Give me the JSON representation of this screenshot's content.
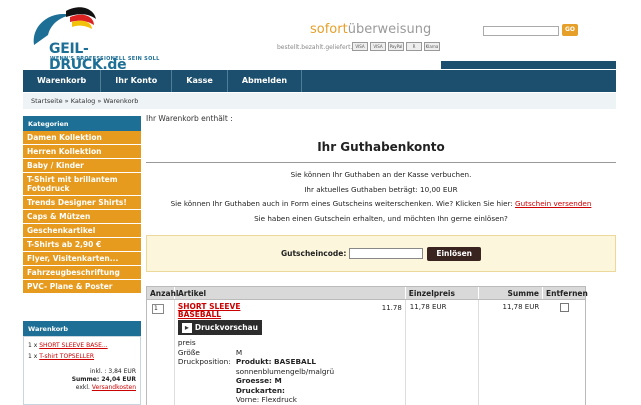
{
  "brand": {
    "logo_text": "GEIL-DRUCK.de",
    "logo_sub": "WENN'S PROFESSIONELL SEIN SOLL"
  },
  "payment": {
    "sofort_a": "sofort",
    "sofort_b": "überweisung",
    "tagline": "bestellt.bezahlt.geliefert.",
    "badges": [
      "VISA",
      "VISA",
      "PayPal",
      "R",
      "Klarna"
    ]
  },
  "search": {
    "placeholder": "",
    "button_label": "GO"
  },
  "nav": {
    "items": [
      "Warenkorb",
      "Ihr Konto",
      "Kasse",
      "Abmelden"
    ]
  },
  "breadcrumb": "Startseite » Katalog » Warenkorb",
  "sidebar": {
    "heading": "Kategorien",
    "items": [
      "Damen Kollektion",
      "Herren Kollektion",
      "Baby / Kinder",
      "T-Shirt mit brillantem Fotodruck",
      "Trends Designer Shirts!",
      "Caps & Mützen",
      "Geschenkartikel",
      "T-Shirts ab 2,90 €",
      "Flyer, Visitenkarten...",
      "Fahrzeugbeschriftung",
      "PVC- Plane & Poster"
    ]
  },
  "cart_box": {
    "heading": "Warenkorb",
    "line1_qty": "1 x",
    "line1_link": "SHORT SLEEVE BASE...",
    "line2_qty": "1 x",
    "line2_link": "T-shirt TOPSELLER",
    "incl": "inkl. : 3,84 EUR",
    "sum": "Summe: 24,04 EUR",
    "excl_prefix": "exkl.",
    "excl_link": "Versandkosten"
  },
  "main": {
    "intro": "Ihr Warenkorb enthält :",
    "title": "Ihr Guthabenkonto",
    "line1": "Sie können Ihr Guthaben an der Kasse verbuchen.",
    "line2": "Ihr aktuelles Guthaben beträgt: 10,00 EUR",
    "line3_text": "Sie können Ihr Guthaben auch in Form eines Gutscheins weiterschenken. Wie? Klicken Sie hier:",
    "line3_link": "Gutschein versenden",
    "line4": "Sie haben einen Gutschein erhalten, und möchten Ihn gerne einlösen?",
    "voucher_label": "Gutscheincode:",
    "voucher_value": "",
    "voucher_button": "Einlösen"
  },
  "table": {
    "headers": [
      "Anzahl",
      "Artikel",
      "Einzelpreis",
      "Summe",
      "Entfernen"
    ],
    "row": {
      "qty": "1",
      "name_line1": "SHORT SLEEVE",
      "name_line2": "BASEBALL",
      "print_button": "Druckvorschau",
      "inline_price": "11.78",
      "unit_price": "11,78 EUR",
      "sum": "11,78 EUR",
      "attrs": [
        {
          "k": "preis",
          "v": ""
        },
        {
          "k": "Größe",
          "v": "M"
        },
        {
          "k": "Druckposition:",
          "v": "Produkt: BASEBALL"
        },
        {
          "k": "",
          "v": "sonnenblumengelb/malgrü"
        },
        {
          "k": "",
          "v": "Groesse: M"
        },
        {
          "k": "",
          "v": "Druckarten:"
        },
        {
          "k": "",
          "v": "Vorne: Flexdruck"
        }
      ]
    }
  },
  "colors": {
    "nav_bg": "#1c4f6e",
    "sidebar_item": "#e69a1e",
    "link_red": "#cc0000",
    "brand_blue": "#1d6f96"
  }
}
